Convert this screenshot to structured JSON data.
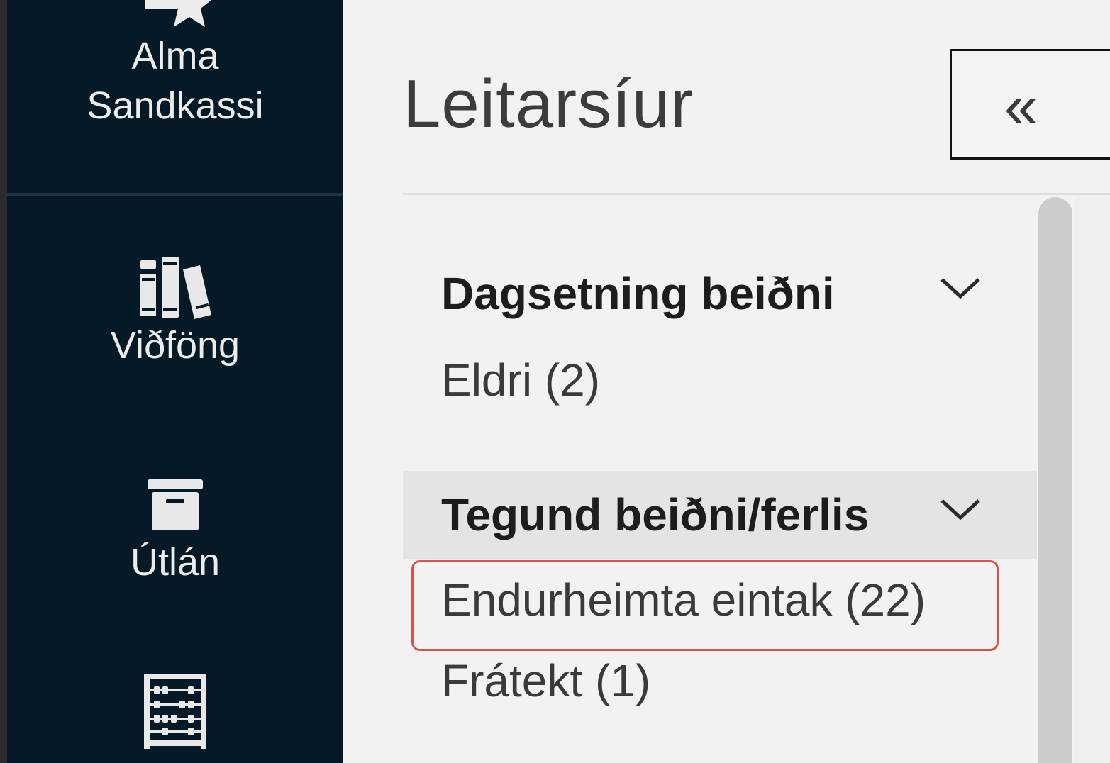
{
  "sidebar": {
    "brand_label": "Alma Sandkassi",
    "brand_line1": "Alma",
    "brand_line2": "Sandkassi",
    "items": [
      {
        "label": "Viðföng",
        "icon": "books-icon"
      },
      {
        "label": "Útlán",
        "icon": "archive-box-icon"
      },
      {
        "label": "",
        "icon": "abacus-icon"
      }
    ]
  },
  "panel": {
    "title": "Leitarsíur",
    "collapse_symbol": "«"
  },
  "facets": [
    {
      "title": "Dagsetning beiðni",
      "values": [
        "Eldri (2)"
      ]
    },
    {
      "title": "Tegund beiðni/ferlis",
      "values": [
        "Endurheimta eintak (22)",
        "Frátekt (1)"
      ],
      "highlighted_value": "Endurheimta eintak (22)"
    }
  ],
  "colors": {
    "sidebar_bg": "#051a26",
    "highlight_border": "#d9534a",
    "panel_bg": "#f2f2f2"
  }
}
